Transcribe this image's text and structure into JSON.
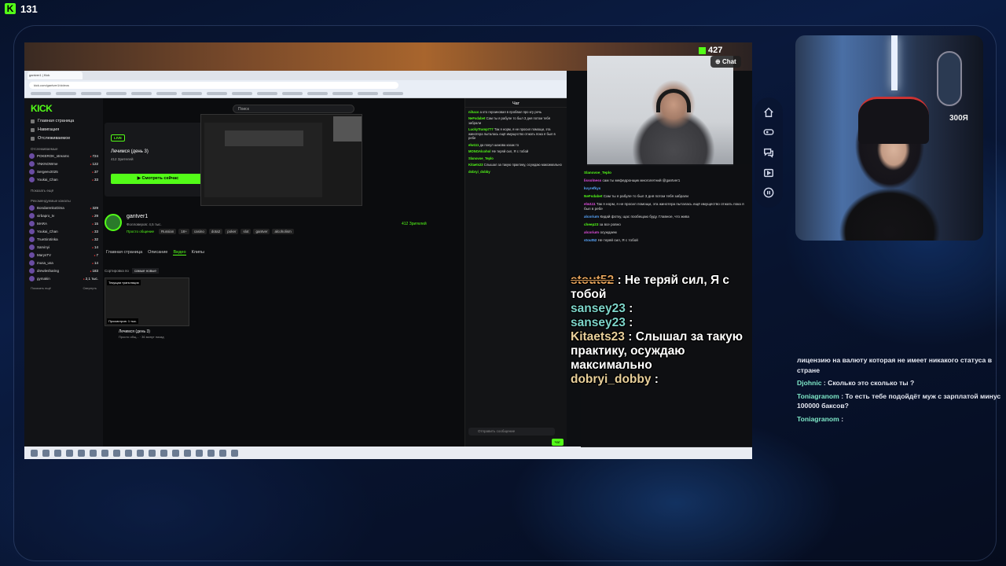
{
  "top": {
    "logo": "K",
    "count": "131"
  },
  "stream": {
    "viewer_count": "427",
    "chat_button": "Chat",
    "big_chat": [
      {
        "user": "stout52",
        "text": ": Не теряй сил, Я с тобой"
      },
      {
        "user": "sansey23",
        "text": ":"
      },
      {
        "user": "sansey23",
        "text": ":"
      },
      {
        "user": "Kitaets23",
        "text": ": Слышал за такую практику, осуждаю максимально"
      },
      {
        "user": "dobryi_dobby",
        "text": ":"
      }
    ]
  },
  "browser": {
    "tab_label": "gantver1 | Kick",
    "url": "kick.com/gantver1/videos"
  },
  "kick": {
    "logo": "KICK",
    "nav": [
      "Главная страница",
      "Навигация",
      "Отслеживаемое"
    ],
    "following_label": "Отслеживаемые",
    "following": [
      {
        "name": "POKEROK_streams",
        "viewers": "724"
      },
      {
        "name": "YNKNOWme",
        "viewers": "122"
      },
      {
        "name": "Sergeev2025",
        "viewers": "37"
      },
      {
        "name": "Youkai_Chan",
        "viewers": "33"
      }
    ],
    "show_more": "Показать ещё",
    "recommended_label": "Рекомендуемые каналы",
    "recommended": [
      {
        "name": "BondarenkoDima",
        "viewers": "329"
      },
      {
        "name": "virbapro_tv",
        "viewers": "29"
      },
      {
        "name": "MARA",
        "viewers": "15"
      },
      {
        "name": "Youkai_Chan",
        "viewers": "33"
      },
      {
        "name": "TrueSirotinka",
        "viewers": "32"
      },
      {
        "name": "Sarvinyi",
        "viewers": "14"
      },
      {
        "name": "MarysTV",
        "viewers": "7"
      },
      {
        "name": "musa_usa",
        "viewers": "14"
      },
      {
        "name": "drewlesharing",
        "viewers": "183"
      },
      {
        "name": "gymakin",
        "viewers": "2,1 тыс."
      }
    ],
    "show_more_2": "Показать ещё",
    "collapse": "Свернуть",
    "search_placeholder": "Поиск",
    "get_kick": "Получить KICKs",
    "live_badge": "LIVE",
    "live_title": "Лечимся (день 3)",
    "live_viewers": "412 Зрителей",
    "watch_button": "▶ Смотреть сейчас",
    "channel_name": "gantver1",
    "followers": "Фолловеров: 4,5 тыс.",
    "tags": [
      "Просто общение",
      "Russian",
      "18+",
      "casino",
      "dota2",
      "poker",
      "slot",
      "gantver",
      "alcoholism"
    ],
    "channel_viewers": "412 Зрителей",
    "tabs": [
      "Главная страница",
      "Описание",
      "Видео",
      "Клипы"
    ],
    "sort_label": "Сортировка по",
    "sort_value": "самые новые",
    "vod_label": "Текущая трансляция",
    "vod_views": "Просмотров: 1 тыс.",
    "vod_title": "Лечимся (день 3)",
    "vod_sub": "Просто общ... · 36 минут назад",
    "chat_header": "Чат",
    "chat_input": "Отправить сообщение",
    "chat_send": "Чат",
    "chat_messages": [
      {
        "user": "nihaco",
        "text": "а кто героиновая в пробвал про кгу речь"
      },
      {
        "user": "NeFsdabet",
        "text": "Сам ты я рабуле то был 3 дня потом тебя забрали"
      },
      {
        "user": "LuckyTramp777",
        "text": "Так я норм, я не просил помощи, эта жинотера пыталась ещё имущество отжать пока я был в ребе"
      },
      {
        "user": "elw111",
        "text": "да понул шакова казак то"
      },
      {
        "user": "MONOAlcohol",
        "text": "Не теряй сил, Я с тобой"
      },
      {
        "user": "Slanovoe_Teplo",
        "text": ""
      },
      {
        "user": "Kitaets23",
        "text": "Слышал за такую практику, осуждаю максимально"
      },
      {
        "user": "dobryi_dobby",
        "text": ""
      }
    ]
  },
  "overlay_chat": [
    {
      "user": "Slanovoe_Teplo",
      "text": ""
    },
    {
      "user": "lissolness",
      "text": "сам ты мефедронщик многолетний @gantver1"
    },
    {
      "user": "kvyrefkys",
      "text": ""
    },
    {
      "user": "NeFsdabet",
      "text": "Сам ты я рабуле то был 3 дня потом тебя забрали"
    },
    {
      "user": "elw111",
      "text": "Так я норм, я не просил помощи, эта жинотера пыталась ещё имущество отжать пока я был в ребе"
    },
    {
      "user": "alcorium",
      "text": "Кидай фотку, щас пообещаю буду. Главное, что жива"
    },
    {
      "user": "cheep23",
      "text": "за все ровно"
    },
    {
      "user": "alcorium",
      "text": "осуждаем"
    },
    {
      "user": "stout52",
      "text": "Не теряй сил, Я с тобой"
    }
  ],
  "right_chat": [
    {
      "user": "",
      "text": "лицензию на валюту которая не имеет никакого статуса в стране"
    },
    {
      "user": "Djohnic",
      "text": ": Сколько это сколько ты ?"
    },
    {
      "user": "Toniagranom",
      "text": ": То есть тебе подойдёт муж с зарплатой минус 100000 баксов?"
    },
    {
      "user": "Toniagranom",
      "text": ":"
    }
  ],
  "webcam": {
    "tag": "300Я"
  },
  "controls": [
    "home-icon",
    "gamepad-icon",
    "chat-bubbles-icon",
    "video-icon",
    "pause-icon"
  ],
  "colors": {
    "kick_green": "#53fc18",
    "bg_navy": "#0b1d45"
  }
}
